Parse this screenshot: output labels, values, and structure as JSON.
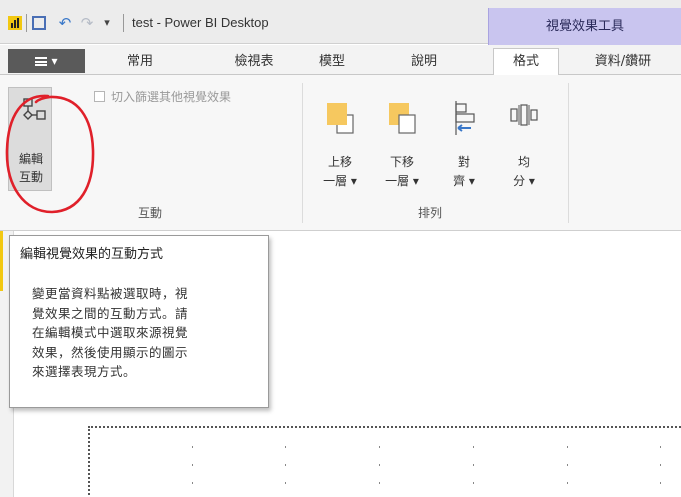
{
  "titlebar": {
    "window_title": "test - Power BI Desktop",
    "context_tab_header": "視覺效果工具",
    "icons": [
      "power-bi-icon",
      "save-icon",
      "undo-icon",
      "redo-icon",
      "customize-quick-access-icon"
    ]
  },
  "tabs": {
    "file_label": "▾",
    "items": [
      {
        "label": "常用"
      },
      {
        "label": "檢視表"
      },
      {
        "label": "模型"
      },
      {
        "label": "說明"
      },
      {
        "label": "格式",
        "active": true
      },
      {
        "label": "資料/鑽研"
      }
    ]
  },
  "ribbon": {
    "edit_interactions": {
      "line1": "編輯",
      "line2": "互動"
    },
    "crossfilter_checkbox": {
      "label": "切入篩選其他視覺效果",
      "checked": false,
      "enabled": false
    },
    "group_interactions_label": "互動",
    "arrange": {
      "bring_forward": {
        "line1": "上移",
        "line2": "一層 ▾"
      },
      "send_backward": {
        "line1": "下移",
        "line2": "一層 ▾"
      },
      "align": {
        "line1": "對",
        "line2": "齊 ▾"
      },
      "distribute": {
        "line1": "均",
        "line2": "分 ▾"
      }
    },
    "group_arrange_label": "排列"
  },
  "tooltip": {
    "title": "編輯視覺效果的互動方式",
    "lines": [
      "變更當資料點被選取時，視",
      "覺效果之間的互動方式。請",
      "在編輯模式中選取來源視覺",
      "效果，然後使用顯示的圖示",
      "來選擇表現方式。"
    ]
  },
  "colors": {
    "accent_yellow": "#f2c811",
    "context_tab": "#c9c5ef",
    "annotation_red": "#e0202a",
    "arrow_blue": "#3a78c9"
  }
}
